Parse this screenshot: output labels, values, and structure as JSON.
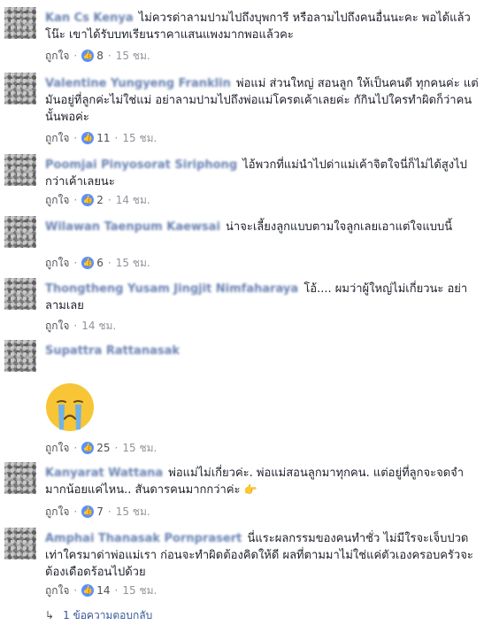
{
  "colors": {
    "author_link": "#365899",
    "reaction_blue": "#5890ff",
    "meta_gray": "#90949c",
    "emoji_yellow": "#f7c536",
    "tear_blue": "#6fb2e8"
  },
  "comments": [
    {
      "author": "Kan Cs Kenya",
      "text": "ไม่ควรด่าลามปามไปถึงบุพการี หรือลามไปถึงคนอื่นนะคะ พอได้แล้วโน๊ะ เขาได้รับบทเรียนราคาแสนแพงมากพอแล้วคะ",
      "like_label": "ถูกใจ",
      "reaction_icon": "thumbs-up-icon",
      "count": "8",
      "time": "15 ชม."
    },
    {
      "author": "Valentine Yungyeng Franklin",
      "text": "พ่อแม่ ส่วนใหญ่ สอนลูก ให้เป็นคนดี ทุกคนค่ะ แต่มันอยู่ที่ลูกค่ะไม่ใช่แม่ อย่าลามปามไปถึงพ่อแม่โครตเค้าเลยค่ะ กักินไปใครทำผิดก็ว่าคนนั้นพอค่ะ",
      "like_label": "ถูกใจ",
      "reaction_icon": "thumbs-up-icon",
      "count": "11",
      "time": "15 ชม."
    },
    {
      "author": "Poomjai Pinyosorat Siriphong",
      "text": "ไอ้พวกที่แม่นำไปด่าแม่เค้าจิตใจนี่ก็ไม่ได้สูงไปกว่าเค้าเลยนะ",
      "like_label": "ถูกใจ",
      "reaction_icon": "thumbs-up-icon",
      "count": "2",
      "time": "14 ชม."
    },
    {
      "author": "Wilawan Taenpum Kaewsai",
      "text": "น่าจะเลี้ยงลูกแบบตามใจลูกเลยเอาแต่ใจแบบนี้",
      "like_label": "ถูกใจ",
      "reaction_icon": "thumbs-up-icon",
      "count": "6",
      "time": "15 ชม."
    },
    {
      "author": "Thongtheng Yusam Jingjit Nimfaharaya",
      "text": "โอ้.... ผมว่าผู้ใหญ่ไม่เกี่ยวนะ อย่าลามเลย",
      "like_label": "ถูกใจ",
      "reaction_icon": "",
      "count": "",
      "time": "14 ชม."
    },
    {
      "author": "Supattra Rattanasak",
      "text": "",
      "like_label": "ถูกใจ",
      "reaction_icon": "thumbs-up-icon",
      "count": "25",
      "time": "15 ชม."
    },
    {
      "author": "Kanyarat Wattana",
      "text": "พ่อแม่ไม่เกี่ยวค่ะ. พ่อแม่สอนลูกมาทุกคน. แต่อยู่ที่ลูกจะจดจำมากน้อยแค่ไหน.. สันดารคนมากกว่าค่ะ",
      "like_label": "ถูกใจ",
      "reaction_icon": "thumbs-up-icon",
      "count": "7",
      "time": "15 ชม."
    },
    {
      "author": "Amphai Thanasak Pornprasert",
      "text": "นี่แระผลกรรมของคนทำชั่ว ไม่มีใรจะเจ็บปวดเท่าใครมาด่าพ่อแม่เรา ก่อนจะทำผิดต้องคิดให้ดี ผลที่ตามมาไม่ใช่แค่ตัวเองครอบครัวจะต้องเดือดร้อนไปด้วย",
      "like_label": "ถูกใจ",
      "reaction_icon": "thumbs-up-icon",
      "count": "14",
      "time": "15 ชม."
    }
  ],
  "reply_link": "1 ข้อความตอบกลับ"
}
